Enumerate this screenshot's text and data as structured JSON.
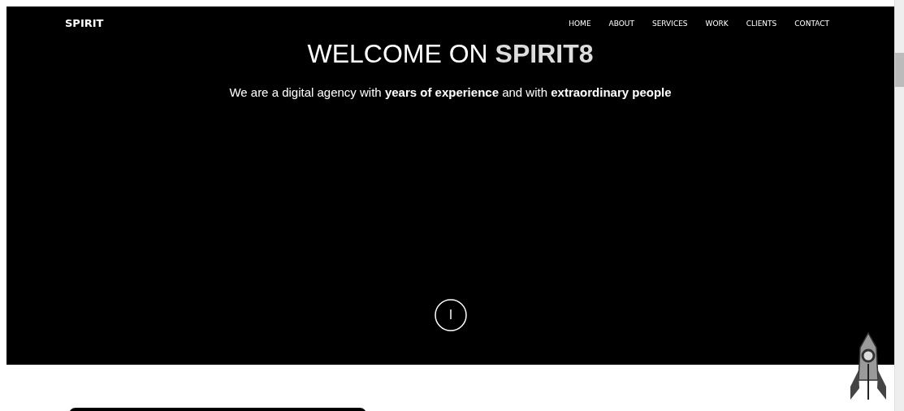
{
  "navbar": {
    "brand": "SPIRIT",
    "links": [
      "HOME",
      "ABOUT",
      "SERVICES",
      "WORK",
      "CLIENTS",
      "CONTACT"
    ]
  },
  "hero": {
    "title": "WELCOME ON **SPIRIT8**",
    "subtitle": "We are a digital agency with **years of experience** and with **extraordinary people**"
  }
}
